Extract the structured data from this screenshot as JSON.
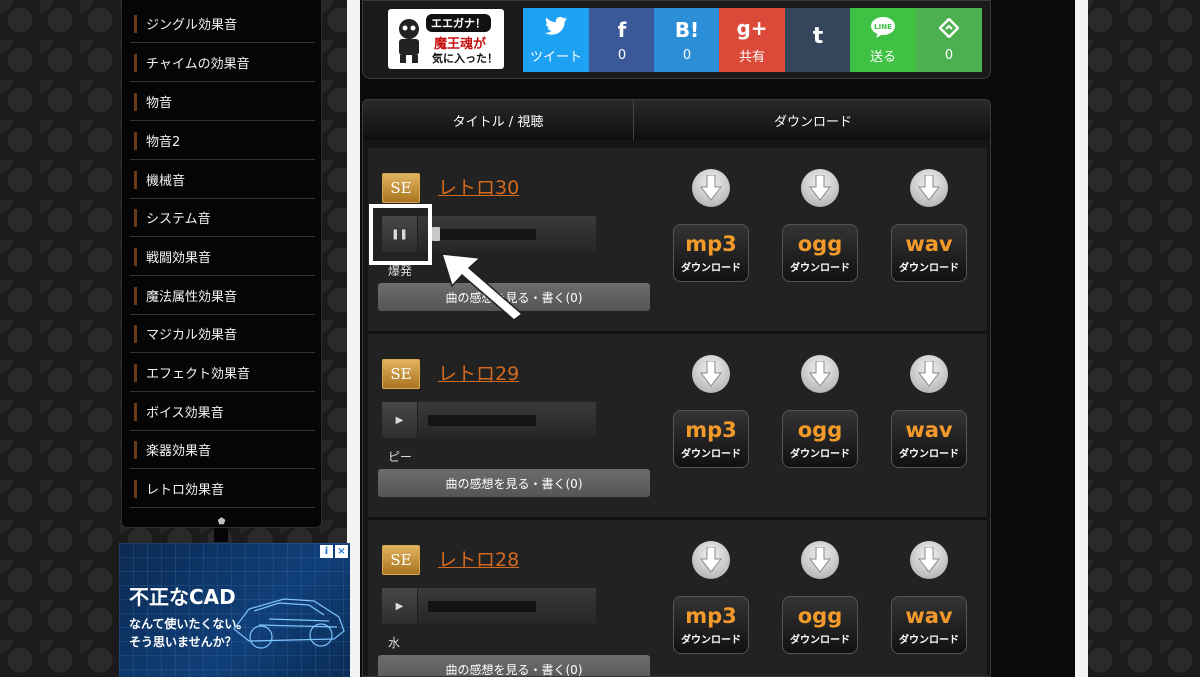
{
  "sidebar": {
    "items": [
      {
        "label": "ジングル効果音"
      },
      {
        "label": "チャイムの効果音"
      },
      {
        "label": "物音"
      },
      {
        "label": "物音2"
      },
      {
        "label": "機械音"
      },
      {
        "label": "システム音"
      },
      {
        "label": "戦闘効果音"
      },
      {
        "label": "魔法属性効果音"
      },
      {
        "label": "マジカル効果音"
      },
      {
        "label": "エフェクト効果音"
      },
      {
        "label": "ボイス効果音"
      },
      {
        "label": "楽器効果音"
      },
      {
        "label": "レトロ効果音"
      }
    ],
    "bottom_icon": "pin-icon"
  },
  "ad": {
    "headline": "不正なCAD",
    "line1": "なんて使いたくない。",
    "line2": "そう思いませんか？",
    "info_icon": "i",
    "close_icon": "×"
  },
  "logo": {
    "bubble": "エエガナ！",
    "line1": "魔王魂が",
    "line2": "気に入った！"
  },
  "share": [
    {
      "icon": "twitter-bird",
      "glyph": "🐦",
      "label": "ツイート",
      "color": "#1da1f2"
    },
    {
      "icon": "facebook-f",
      "glyph": "f",
      "label": "0",
      "color": "#3b5998"
    },
    {
      "icon": "hatena-b",
      "glyph": "B!",
      "label": "0",
      "color": "#2c8ed6"
    },
    {
      "icon": "google-plus",
      "glyph": "g+",
      "label": "共有",
      "color": "#db4a39"
    },
    {
      "icon": "tumblr-t",
      "glyph": "t",
      "label": "",
      "color": "#35465c"
    },
    {
      "icon": "line-bubble",
      "glyph": "LINE",
      "label": "送る",
      "color": "#3fc144"
    },
    {
      "icon": "feedly",
      "glyph": "⟁",
      "label": "0",
      "color": "#4caf50"
    }
  ],
  "table": {
    "col_title": "タイトル / 視聴",
    "col_download": "ダウンロード",
    "tracks": [
      {
        "badge": "SE",
        "title": "レトロ30",
        "name": "爆発",
        "playing": true,
        "player_glyph": "❚❚",
        "comment": "曲の感想を見る・書く(0)",
        "progress": 0.04
      },
      {
        "badge": "SE",
        "title": "レトロ29",
        "name": "ピー",
        "playing": false,
        "player_glyph": "▶",
        "comment": "曲の感想を見る・書く(0)",
        "progress": 0
      },
      {
        "badge": "SE",
        "title": "レトロ28",
        "name": "水",
        "playing": false,
        "player_glyph": "▶",
        "comment": "曲の感想を見る・書く(0)",
        "progress": 0
      }
    ],
    "formats": [
      {
        "format": "mp3",
        "label": "ダウンロード"
      },
      {
        "format": "ogg",
        "label": "ダウンロード"
      },
      {
        "format": "wav",
        "label": "ダウンロード"
      }
    ]
  }
}
